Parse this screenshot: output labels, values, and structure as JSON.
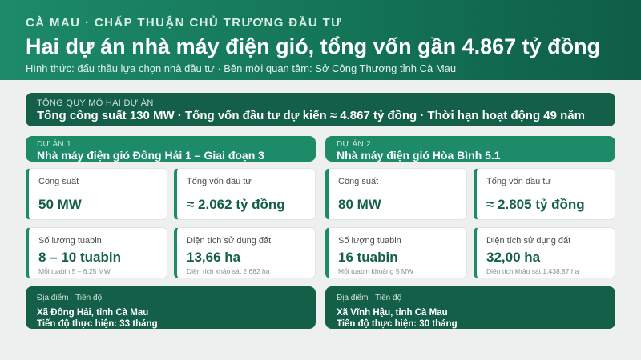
{
  "header": {
    "kicker": "CÀ MAU · CHẤP THUẬN CHỦ TRƯƠNG ĐẦU TƯ",
    "title": "Hai dự án nhà máy điện gió, tổng vốn gần 4.867 tỷ đồng",
    "subtitle": "Hình thức: đấu thầu lựa chọn nhà đầu tư · Bên mời quan tâm: Sở Công Thương tỉnh Cà Mau"
  },
  "summary": {
    "label": "TỔNG QUY MÔ HAI DỰ ÁN",
    "text": "Tổng công suất 130 MW · Tổng vốn đầu tư dự kiến ≈ 4.867 tỷ đồng · Thời hạn hoạt động 49 năm"
  },
  "projects": [
    {
      "label": "DỰ ÁN 1",
      "name": "Nhà máy điện gió Đông Hải 1 – Giai đoạn 3",
      "capacity": {
        "label": "Công suất",
        "value": "50 MW"
      },
      "capital": {
        "label": "Tổng vốn đầu tư",
        "value": "≈ 2.062 tỷ đồng"
      },
      "turbines": {
        "label": "Số lượng tuabin",
        "value": "8 – 10 tuabin",
        "note": "Mỗi tuabin 5 – 6,25 MW"
      },
      "area": {
        "label": "Diện tích sử dụng đất",
        "value": "13,66 ha",
        "note": "Diện tích khảo sát 2.682 ha"
      },
      "location": {
        "label": "Địa điểm · Tiến độ",
        "place": "Xã Đông Hải, tỉnh Cà Mau",
        "schedule": "Tiến độ thực hiện: 33 tháng"
      }
    },
    {
      "label": "DỰ ÁN 2",
      "name": "Nhà máy điện gió Hòa Bình 5.1",
      "capacity": {
        "label": "Công suất",
        "value": "80 MW"
      },
      "capital": {
        "label": "Tổng vốn đầu tư",
        "value": "≈ 2.805 tỷ đồng"
      },
      "turbines": {
        "label": "Số lượng tuabin",
        "value": "16 tuabin",
        "note": "Mỗi tuabin khoảng 5 MW"
      },
      "area": {
        "label": "Diện tích sử dụng đất",
        "value": "32,00 ha",
        "note": "Diện tích khảo sát 1.438,87 ha"
      },
      "location": {
        "label": "Địa điểm · Tiến độ",
        "place": "Xã Vĩnh Hậu, tỉnh Cà Mau",
        "schedule": "Tiến độ thực hiện: 30 tháng"
      }
    }
  ]
}
